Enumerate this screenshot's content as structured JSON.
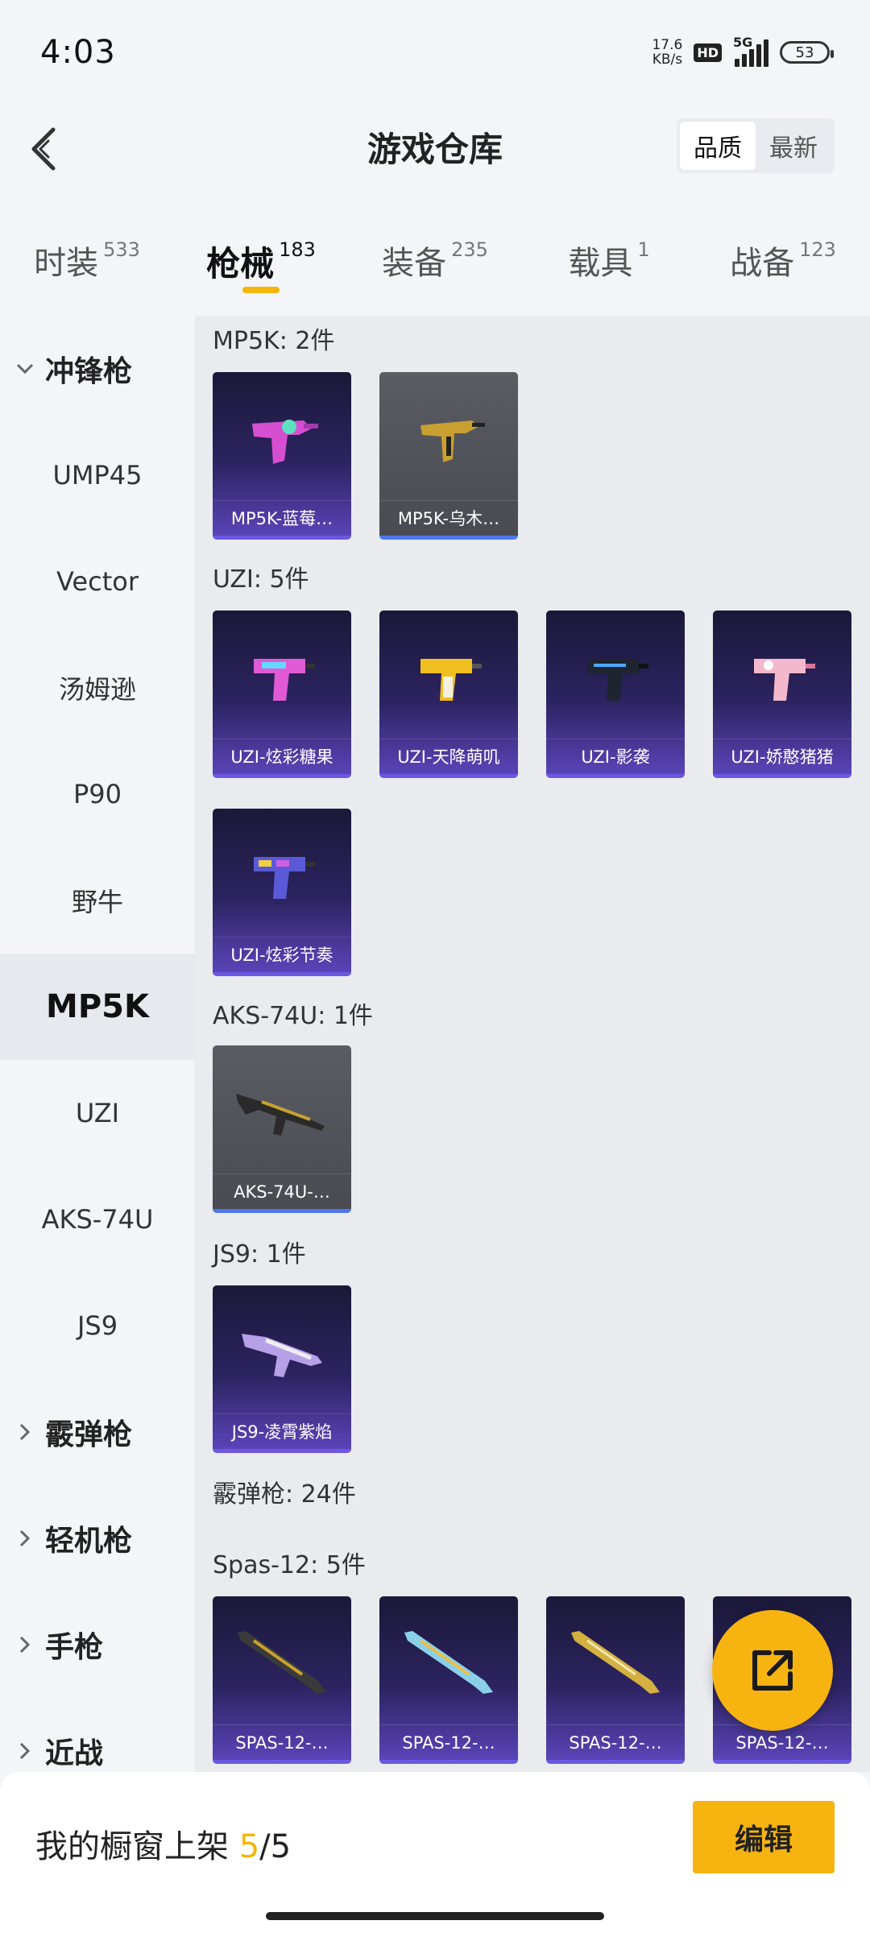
{
  "status": {
    "time": "4:03",
    "net_speed": "17.6",
    "net_unit": "KB/s",
    "hd": "HD",
    "network": "5G",
    "battery": "53"
  },
  "header": {
    "title": "游戏仓库",
    "sort_quality": "品质",
    "sort_newest": "最新"
  },
  "tabs": [
    {
      "label": "时装",
      "count": "533"
    },
    {
      "label": "枪械",
      "count": "183"
    },
    {
      "label": "装备",
      "count": "235"
    },
    {
      "label": "载具",
      "count": "1"
    },
    {
      "label": "战备",
      "count": "123"
    }
  ],
  "sidebar": {
    "smg_group": "冲锋枪",
    "smg_items": [
      "UMP45",
      "Vector",
      "汤姆逊",
      "P90",
      "野牛",
      "MP5K",
      "UZI",
      "AKS-74U",
      "JS9"
    ],
    "other_groups": [
      "霰弹枪",
      "轻机枪",
      "手枪",
      "近战"
    ]
  },
  "sections": {
    "mp5k": {
      "title": "MP5K: 2件",
      "items": [
        "MP5K-蓝莓…",
        "MP5K-乌木…"
      ]
    },
    "uzi": {
      "title": "UZI: 5件",
      "items": [
        "UZI-炫彩糖果",
        "UZI-天降萌叽",
        "UZI-影袭",
        "UZI-娇憨猪猪",
        "UZI-炫彩节奏"
      ]
    },
    "aks": {
      "title": "AKS-74U: 1件",
      "items": [
        "AKS-74U-…"
      ]
    },
    "js9": {
      "title": "JS9: 1件",
      "items": [
        "JS9-凌霄紫焰"
      ]
    },
    "shotgun": {
      "title": "霰弹枪: 24件"
    },
    "spas": {
      "title": "Spas-12: 5件",
      "items": [
        "SPAS-12-…",
        "SPAS-12-…",
        "SPAS-12-…",
        "SPAS-12-…"
      ]
    }
  },
  "bottom": {
    "showcase_label": "我的橱窗上架 ",
    "showcase_count": "5",
    "showcase_total": "/5",
    "edit_label": "编辑"
  },
  "colors": {
    "accent": "#f5b50a",
    "card_purple": "#2c2360",
    "card_gray": "#4a4b52"
  }
}
